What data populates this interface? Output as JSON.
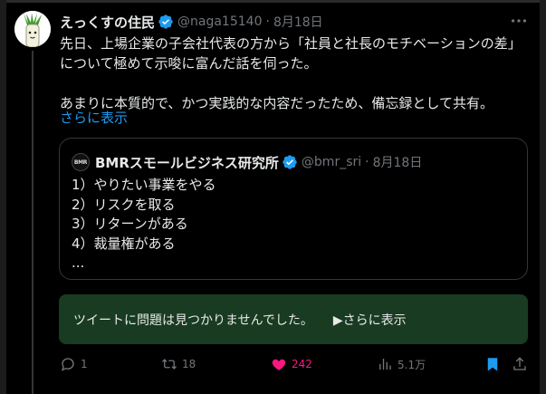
{
  "tweet": {
    "display_name": "えっくすの住民",
    "handle": "@naga15140",
    "separator": "·",
    "date": "8月18日",
    "text_lines": [
      "先日、上場企業の子会社代表の方から「社員と社長のモチベーションの差」",
      "について極めて示唆に富んだ話を伺った。",
      "",
      "あまりに本質的で、かつ実践的な内容だったため、備忘録として共有。"
    ],
    "show_more": "さらに表示"
  },
  "quote": {
    "avatar_text": "BMR",
    "display_name": "BMRスモールビジネス研究所",
    "handle": "@bmr_sri",
    "separator": "·",
    "date": "8月18日",
    "lines": [
      "1）やりたい事業をやる",
      "2）リスクを取る",
      "3）リターンがある",
      "4）裁量権がある",
      "..."
    ]
  },
  "notice": {
    "text": "ツイートに問題は見つかりませんでした。",
    "more": "▶さらに表示"
  },
  "actions": {
    "reply_count": "1",
    "retweet_count": "18",
    "like_count": "242",
    "views_count": "5.1万"
  },
  "colors": {
    "background": "#000000",
    "text": "#e7e9ea",
    "muted": "#71767b",
    "link": "#1d9bf0",
    "verified": "#1d9bf0",
    "like": "#f91880",
    "bookmark": "#1d9bf0",
    "notice_bg": "#193b21"
  },
  "icons": [
    "verified-badge-icon",
    "more-icon",
    "reply-icon",
    "retweet-icon",
    "like-icon",
    "views-icon",
    "bookmark-icon",
    "share-icon"
  ]
}
